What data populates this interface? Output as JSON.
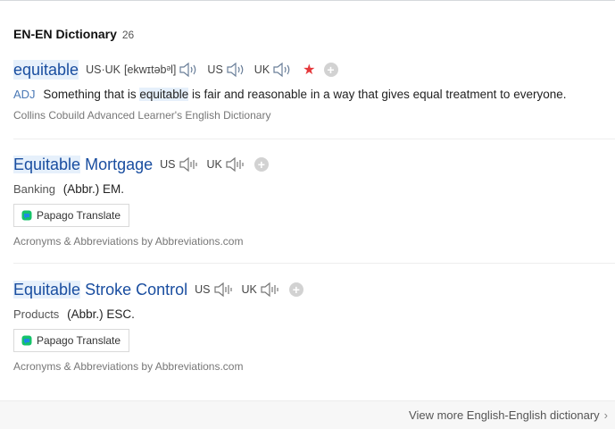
{
  "section": {
    "title": "EN-EN Dictionary",
    "count": "26"
  },
  "entries": [
    {
      "headword": "equitable",
      "pron_us_uk_label": "US·UK",
      "phonetic": "[ekwɪtəbᵊl]",
      "us_label": "US",
      "uk_label": "UK",
      "pos": "ADJ",
      "def_before": "Something that is",
      "def_highlight": "equitable",
      "def_after": "is fair and reasonable in a way that gives equal treatment to everyone.",
      "source": "Collins Cobuild Advanced Learner's English Dictionary"
    },
    {
      "headword_highlight": "Equitable",
      "headword_rest": "Mortgage",
      "us_label": "US",
      "uk_label": "UK",
      "category": "Banking",
      "definition": "(Abbr.) EM.",
      "translate_label": "Papago Translate",
      "source": "Acronyms & Abbreviations by Abbreviations.com"
    },
    {
      "headword_highlight": "Equitable",
      "headword_rest": "Stroke Control",
      "us_label": "US",
      "uk_label": "UK",
      "category": "Products",
      "definition": "(Abbr.) ESC.",
      "translate_label": "Papago Translate",
      "source": "Acronyms & Abbreviations by Abbreviations.com"
    }
  ],
  "footer": {
    "view_more": "View more English-English dictionary"
  },
  "icons": {
    "speaker": "speaker-icon",
    "star": "star-icon",
    "add": "add-icon",
    "papago": "papago-icon",
    "chevron": "chevron-right-icon"
  },
  "colors": {
    "headword": "#1a4ea0",
    "highlight": "#e6f0fb",
    "star": "#e5383b",
    "pos": "#4a78b5"
  }
}
